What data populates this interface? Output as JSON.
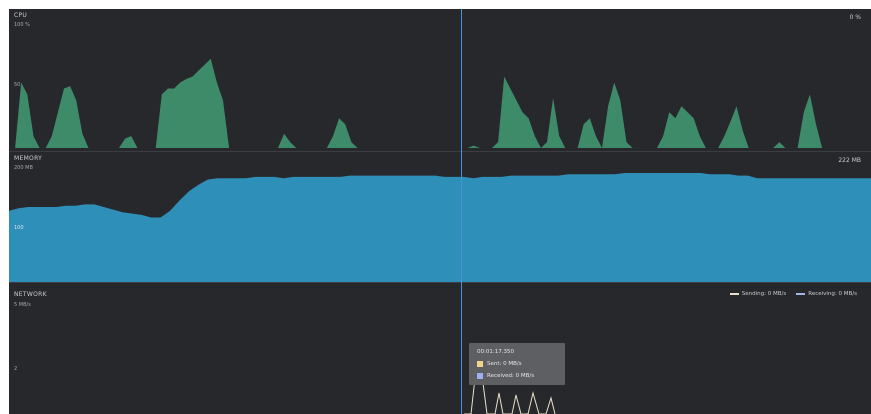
{
  "top_ticks": [
    "",
    "",
    ""
  ],
  "cpu": {
    "title": "CPU",
    "scale_top": "100 %",
    "scale_mid": "50",
    "current": "0 %",
    "color": "#3e8b6a",
    "levels": [
      0,
      0,
      0.55,
      0.45,
      0.1,
      0,
      0,
      0.1,
      0.3,
      0.5,
      0.52,
      0.4,
      0.12,
      0,
      0,
      0,
      0,
      0,
      0,
      0.08,
      0.1,
      0,
      0,
      0,
      0,
      0.45,
      0.5,
      0.5,
      0.55,
      0.58,
      0.6,
      0.65,
      0.7,
      0.75,
      0.55,
      0.4,
      0,
      0,
      0,
      0,
      0,
      0,
      0,
      0,
      0,
      0.12,
      0.05,
      0,
      0,
      0,
      0,
      0,
      0,
      0.1,
      0.25,
      0.2,
      0.05,
      0,
      0,
      0,
      0,
      0,
      0,
      0,
      0,
      0,
      0,
      0,
      0,
      0,
      0,
      0,
      0,
      0,
      0,
      0,
      0.02,
      0,
      0,
      0,
      0.05,
      0.6,
      0.5,
      0.4,
      0.3,
      0.25,
      0.1,
      0,
      0.05,
      0.42,
      0.1,
      0,
      0,
      0,
      0.2,
      0.25,
      0.1,
      0,
      0.35,
      0.55,
      0.4,
      0.05,
      0,
      0,
      0,
      0,
      0,
      0.1,
      0.3,
      0.25,
      0.35,
      0.3,
      0.25,
      0.1,
      0,
      0,
      0,
      0.1,
      0.22,
      0.35,
      0.15,
      0,
      0,
      0,
      0,
      0,
      0.05,
      0,
      0,
      0,
      0.3,
      0.45,
      0.2,
      0,
      0,
      0,
      0,
      0,
      0,
      0,
      0,
      0
    ]
  },
  "memory": {
    "title": "MEMORY",
    "scale_top": "200 MB",
    "scale_mid": "100",
    "current": "222 MB",
    "color": "#2e8fb8",
    "levels": [
      0.55,
      0.57,
      0.58,
      0.58,
      0.58,
      0.58,
      0.59,
      0.59,
      0.6,
      0.6,
      0.58,
      0.56,
      0.54,
      0.53,
      0.52,
      0.5,
      0.5,
      0.55,
      0.63,
      0.7,
      0.75,
      0.79,
      0.8,
      0.8,
      0.8,
      0.8,
      0.81,
      0.81,
      0.81,
      0.8,
      0.81,
      0.81,
      0.81,
      0.81,
      0.81,
      0.81,
      0.82,
      0.82,
      0.82,
      0.82,
      0.82,
      0.82,
      0.82,
      0.82,
      0.82,
      0.82,
      0.81,
      0.81,
      0.81,
      0.8,
      0.81,
      0.81,
      0.81,
      0.82,
      0.82,
      0.82,
      0.82,
      0.82,
      0.82,
      0.83,
      0.83,
      0.83,
      0.83,
      0.83,
      0.83,
      0.84,
      0.84,
      0.84,
      0.84,
      0.84,
      0.84,
      0.84,
      0.84,
      0.84,
      0.83,
      0.83,
      0.83,
      0.82,
      0.82,
      0.8,
      0.8,
      0.8,
      0.8,
      0.8,
      0.8,
      0.8,
      0.8,
      0.8,
      0.8,
      0.8,
      0.8,
      0.8
    ]
  },
  "network": {
    "title": "NETWORK",
    "scale_top": "5 MB/s",
    "scale_mid": "2",
    "legend": {
      "sending": "Sending: 0 MB/s",
      "receiving": "Receiving: 0 MB/s",
      "sending_color": "#e8e0c8",
      "receiving_color": "#9fb7e6"
    }
  },
  "tooltip": {
    "time": "00:01:17.350",
    "sent": "Sent: 0 MB/s",
    "received": "Received: 0 MB/s",
    "sent_color": "#f3d38a",
    "received_color": "#9bb2f2"
  },
  "cursor_color": "#4a90e2"
}
